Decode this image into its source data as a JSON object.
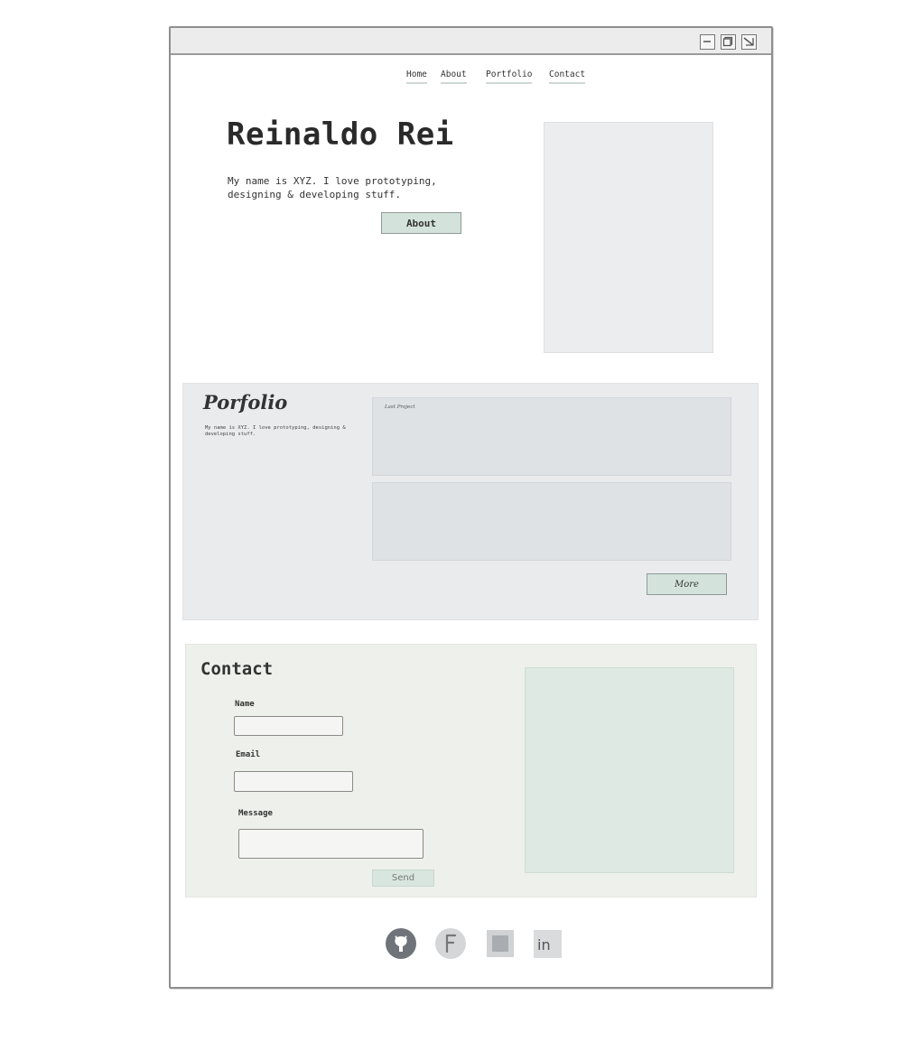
{
  "nav": {
    "items": [
      {
        "label": "Home"
      },
      {
        "label": "About"
      },
      {
        "label": "Portfolio"
      },
      {
        "label": "Contact"
      }
    ]
  },
  "hero": {
    "title": "Reinaldo Rei",
    "text": "My name is XYZ. I love prototyping, designing & developing stuff.",
    "button_label": "About"
  },
  "portfolio": {
    "title": "Porfolio",
    "text": "My name is XYZ. I love prototyping, designing & developing stuff.",
    "card_label": "Last Project",
    "more_label": "More"
  },
  "contact": {
    "title": "Contact",
    "name_label": "Name",
    "email_label": "Email",
    "message_label": "Message",
    "send_label": "Send"
  },
  "social": {
    "icons": [
      "github-icon",
      "facebook-icon",
      "instagram-icon",
      "linkedin-icon"
    ]
  },
  "colors": {
    "accent_green": "#d3e3dc",
    "portfolio_bg": "#e9ebed",
    "contact_bg": "#eef0eb",
    "map_bg": "#dde9e2"
  }
}
